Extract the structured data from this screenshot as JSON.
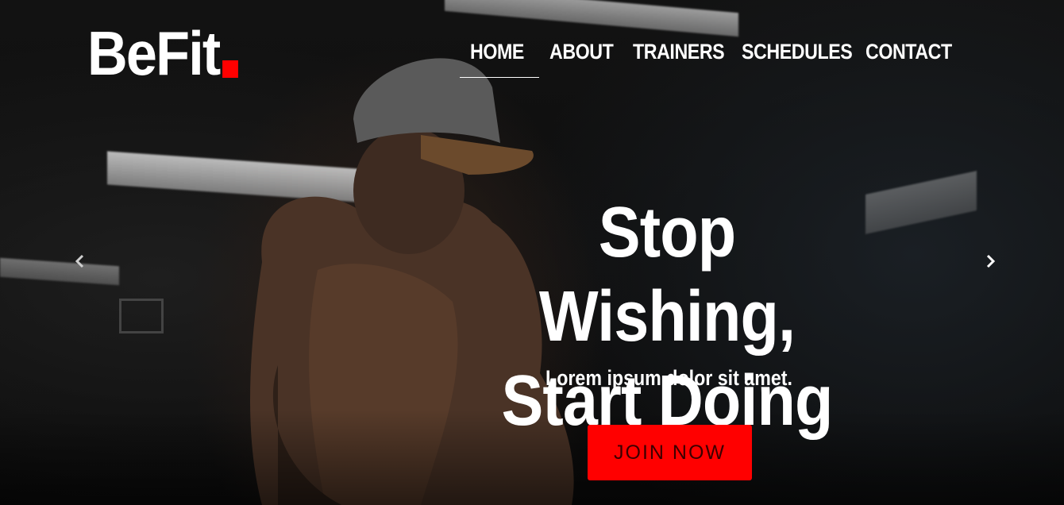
{
  "brand": {
    "name": "BeFit",
    "accent_color": "#ff0000"
  },
  "nav": {
    "items": [
      {
        "label": "HOME",
        "active": true
      },
      {
        "label": "ABOUT",
        "active": false
      },
      {
        "label": "TRAINERS",
        "active": false
      },
      {
        "label": "SCHEDULES",
        "active": false
      },
      {
        "label": "CONTACT",
        "active": false
      }
    ]
  },
  "hero": {
    "headline_line1": "Stop Wishing,",
    "headline_line2": "Start Doing",
    "subtitle": "Lorem ipsum dolor sit amet.",
    "cta_label": "JOIN NOW",
    "prev_icon": "chevron-left-icon",
    "next_icon": "chevron-right-icon"
  }
}
